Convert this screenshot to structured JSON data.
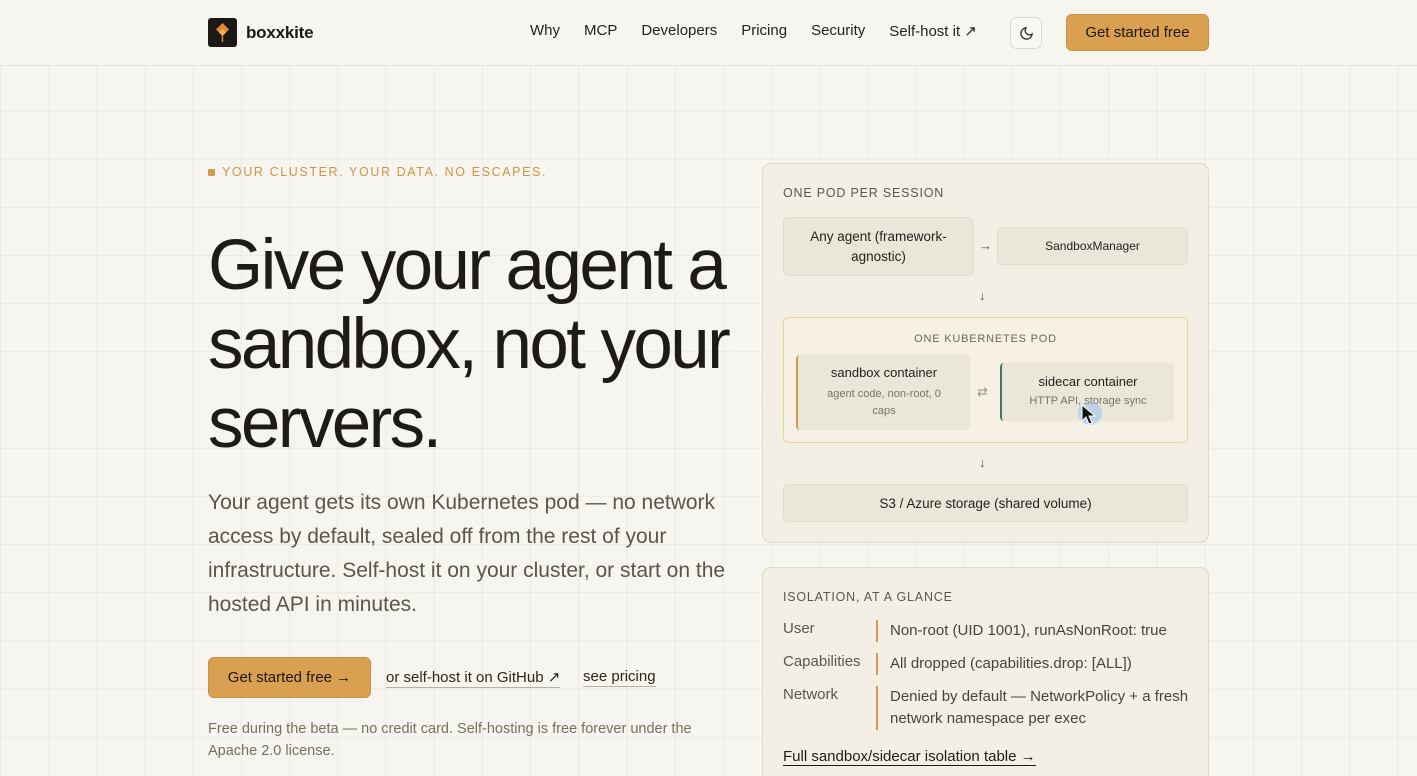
{
  "header": {
    "brand": "boxxkite",
    "nav": [
      "Why",
      "MCP",
      "Developers",
      "Pricing",
      "Security",
      "Self-host it ↗"
    ],
    "theme_toggle_icon": "moon-icon",
    "cta": "Get started free"
  },
  "hero": {
    "eyebrow": "YOUR CLUSTER. YOUR DATA. NO ESCAPES.",
    "headline": "Give your agent a sandbox, not your servers.",
    "lede": "Your agent gets its own Kubernetes pod — no network access by default, sealed off from the rest of your infrastructure. Self-host it on your cluster, or start on the hosted API in minutes.",
    "primary_cta": "Get started free →",
    "github_link": "or self-host it on GitHub ↗",
    "pricing_link": "see pricing",
    "fineprint": "Free during the beta — no credit card. Self-hosting is free forever under the Apache 2.0 license."
  },
  "diagram": {
    "title": "ONE POD PER SESSION",
    "agent_box": "Any agent (framework-agnostic)",
    "manager_box": "SandboxManager",
    "arrow_right": "→",
    "arrow_down": "↓",
    "pod_label": "ONE KUBERNETES POD",
    "sandbox_title": "sandbox container",
    "sandbox_sub": "agent code, non-root, 0 caps",
    "exchange": "⇄",
    "sidecar_title": "sidecar container",
    "sidecar_sub": "HTTP API, storage sync",
    "storage_box": "S3 / Azure storage (shared volume)"
  },
  "isolation": {
    "title": "ISOLATION, AT A GLANCE",
    "rows": [
      {
        "key": "User",
        "value": "Non-root (UID 1001), runAsNonRoot: true"
      },
      {
        "key": "Capabilities",
        "value": "All dropped (capabilities.drop: [ALL])"
      },
      {
        "key": "Network",
        "value": "Denied by default — NetworkPolicy + a fresh network namespace per exec"
      }
    ],
    "link": "Full sandbox/sidecar isolation table →"
  },
  "colors": {
    "accent": "#d9a052",
    "sidecar_accent": "#3d7a6a",
    "background": "#f7f5f0"
  }
}
